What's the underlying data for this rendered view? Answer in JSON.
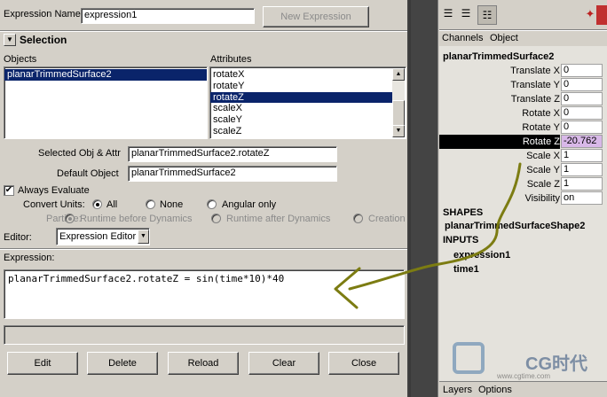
{
  "editor": {
    "expression_name_label": "Expression Name",
    "expression_name_value": "expression1",
    "new_expression_label": "New Expression",
    "selection_header": "Selection",
    "objects_label": "Objects",
    "attributes_label": "Attributes",
    "objects": [
      "planarTrimmedSurface2"
    ],
    "attributes": [
      {
        "label": "rotateX",
        "selected": false
      },
      {
        "label": "rotateY",
        "selected": false
      },
      {
        "label": "rotateZ",
        "selected": true
      },
      {
        "label": "scaleX",
        "selected": false
      },
      {
        "label": "scaleY",
        "selected": false
      },
      {
        "label": "scaleZ",
        "selected": false
      }
    ],
    "selected_obj_attr_label": "Selected Obj & Attr",
    "selected_obj_attr_value": "planarTrimmedSurface2.rotateZ",
    "default_object_label": "Default Object",
    "default_object_value": "planarTrimmedSurface2",
    "always_evaluate_label": "Always Evaluate",
    "always_evaluate_checked": true,
    "convert_units_label": "Convert Units:",
    "convert_units_options": [
      "All",
      "None",
      "Angular only"
    ],
    "convert_units_selected": "All",
    "particle_label": "Particle:",
    "particle_options": [
      "Runtime before Dynamics",
      "Runtime after Dynamics",
      "Creation"
    ],
    "editor_label": "Editor:",
    "editor_value": "Expression Editor",
    "expression_label": "Expression:",
    "expression_text": "planarTrimmedSurface2.rotateZ = sin(time*10)*40",
    "buttons": [
      "Edit",
      "Delete",
      "Reload",
      "Clear",
      "Close"
    ]
  },
  "channel_box": {
    "menu_channels": "Channels",
    "menu_object": "Object",
    "object_name": "planarTrimmedSurface2",
    "channels": [
      {
        "label": "Translate X",
        "value": "0"
      },
      {
        "label": "Translate Y",
        "value": "0"
      },
      {
        "label": "Translate Z",
        "value": "0"
      },
      {
        "label": "Rotate X",
        "value": "0"
      },
      {
        "label": "Rotate Y",
        "value": "0"
      },
      {
        "label": "Rotate Z",
        "value": "-20.762",
        "highlight": true
      },
      {
        "label": "Scale X",
        "value": "1"
      },
      {
        "label": "Scale Y",
        "value": "1"
      },
      {
        "label": "Scale Z",
        "value": "1"
      },
      {
        "label": "Visibility",
        "value": "on"
      }
    ],
    "shapes_label": "SHAPES",
    "shape_name": "planarTrimmedSurfaceShape2",
    "inputs_label": "INPUTS",
    "inputs": [
      "expression1",
      "time1"
    ],
    "bottom_tabs": [
      "Layers",
      "Options"
    ]
  },
  "watermark": {
    "text": "CG时代",
    "sub": "www.cgtime.com"
  },
  "colors": {
    "panel": "#d4d0c8",
    "selection": "#0a246a",
    "annotation": "#7c7c12",
    "highlight_value": "#d8b8e8"
  }
}
